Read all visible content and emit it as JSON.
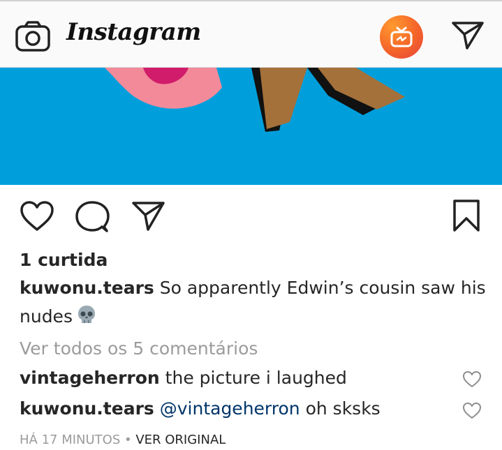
{
  "header": {
    "logo_text": "Instagram",
    "icons": [
      "camera-icon",
      "igtv-icon",
      "direct-message-icon"
    ],
    "igtv_color": "#f4642a"
  },
  "post": {
    "image_bg_color": "#009fdc",
    "likes_text": "1 curtida",
    "caption": {
      "username": "kuwonu.tears",
      "text_line1": " So apparently Edwin’s cousin saw his",
      "text_line2": "nudes",
      "emoji": "skull-emoji"
    },
    "view_all_comments": "Ver todos os 5 comentários",
    "comments": [
      {
        "username": "vintageherron",
        "text": " the picture i laughed"
      },
      {
        "username": "kuwonu.tears",
        "mention": "@vintageherron",
        "text": " oh sksks"
      }
    ],
    "timestamp": "HÁ 17 MINUTOS",
    "separator": " • ",
    "see_original": "VER ORIGINAL"
  }
}
